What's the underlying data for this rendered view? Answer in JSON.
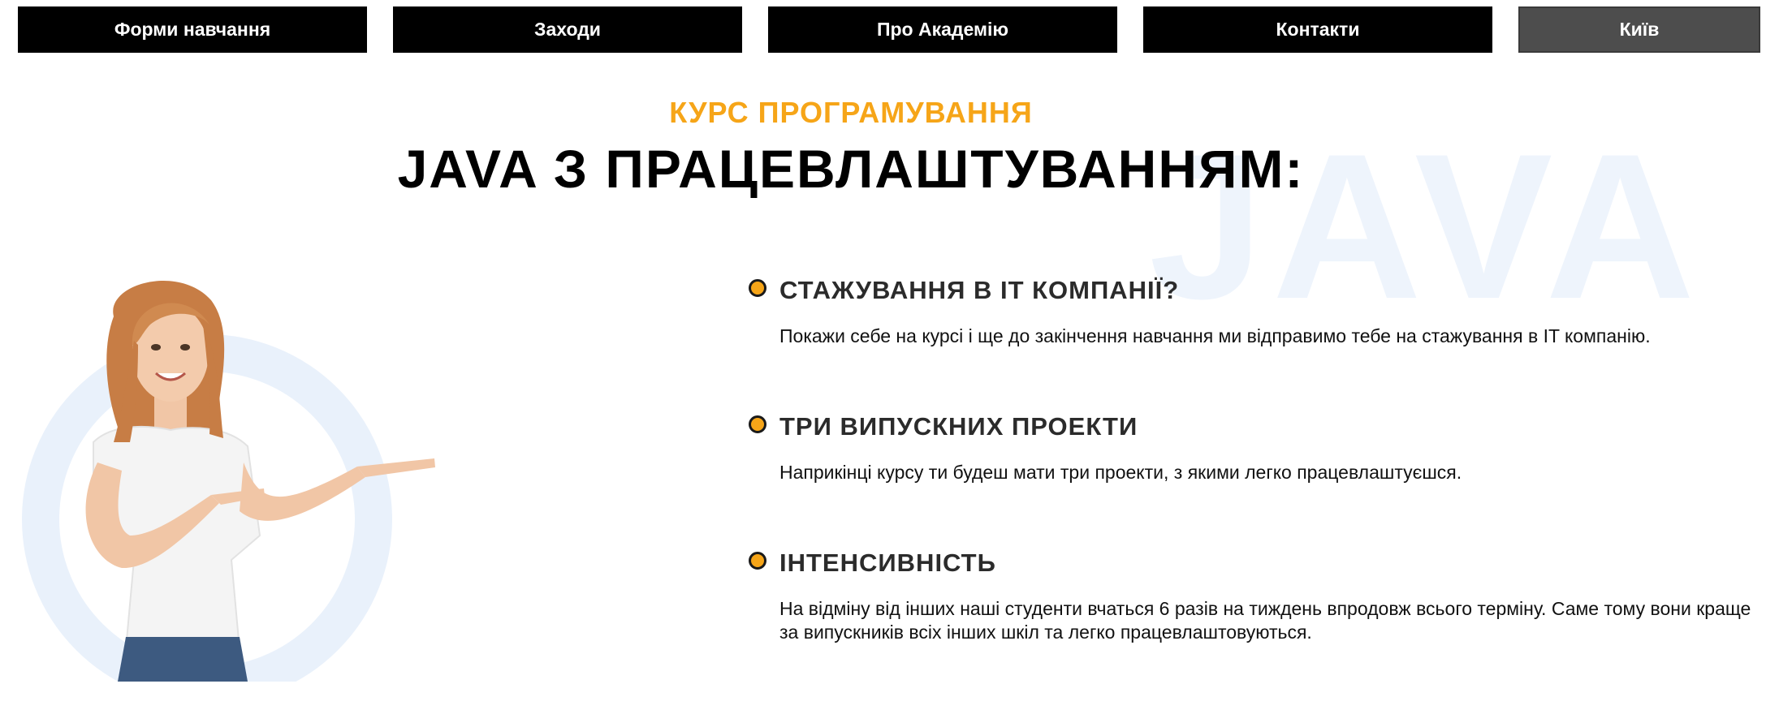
{
  "nav": {
    "items": [
      "Форми навчання",
      "Заходи",
      "Про Академію",
      "Контакти"
    ],
    "city": "Київ"
  },
  "hero": {
    "eyebrow": "КУРС ПРОГРАМУВАННЯ",
    "title": "JAVA З ПРАЦЕВЛАШТУВАННЯМ:",
    "watermark": "JAVA"
  },
  "features": [
    {
      "title": "СТАЖУВАННЯ В IT КОМПАНІЇ?",
      "text": "Покажи себе на курсі і ще до закінчення навчання ми відправимо тебе на стажування в IT компанію."
    },
    {
      "title": "ТРИ ВИПУСКНИХ ПРОЕКТИ",
      "text": "Наприкінці курсу ти будеш мати три проекти, з якими легко працевлаштуєшся."
    },
    {
      "title": "ІНТЕНСИВНІСТЬ",
      "text": "На відміну від інших наші студенти вчаться 6 разів на тиждень впродовж всього терміну. Саме тому вони краще за випускників всіх інших шкіл та легко працевлаштовуються."
    }
  ],
  "colors": {
    "accent": "#f6a518",
    "nav_bg": "#000000",
    "nav_city_bg": "#4d4d4d",
    "watermark": "#eef4fc",
    "circle": "#e9f1fb"
  }
}
